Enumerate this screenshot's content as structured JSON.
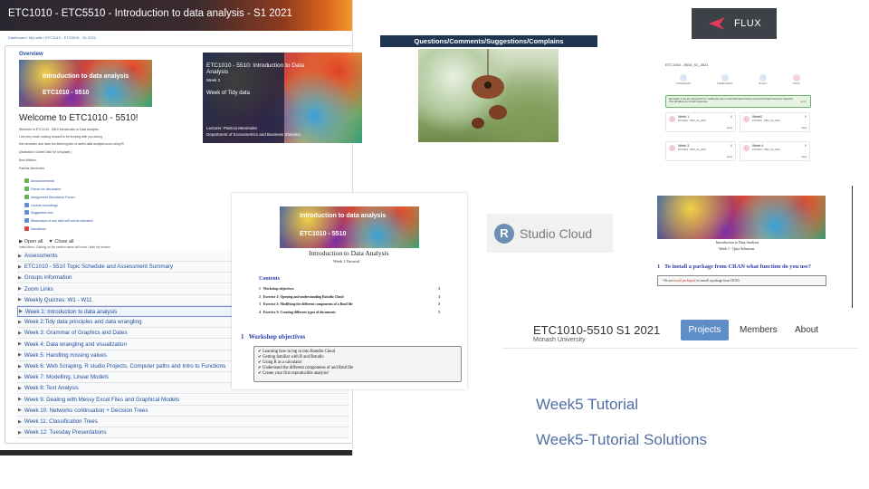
{
  "moodle": {
    "title": "ETC1010 - ETC5510 - Introduction to data analysis - S1 2021",
    "breadcrumb": "Dashboard / My units / ETC1010 - ETC5510 - S1 2021",
    "overview_label": "Overview",
    "banner_title": "Introduction to data analysis",
    "banner_code": "ETC1010 - 5510",
    "welcome": "Welcome to ETC1010 - 5510!",
    "intro_lines": [
      "Welcome to ETC1010 - 5510 Introduction to Data Analysis.",
      "I am very much looking forward to be working with you during",
      "this semester and have fun learning lots of useful data analysis tools using R!",
      "(Illustration: Daniel Olah for Unsplash )",
      "Best Wishes,",
      "Patricia Menéndez"
    ],
    "resources": [
      "Announcements",
      "Forum for discussion",
      "Assignment Discussion Forum",
      "Lecture recordings",
      "Suggestion box",
      "Misconduct of any kind will not be tolerated",
      "Disclaimer"
    ],
    "open_all": "Open all",
    "close_all": "Close all",
    "note": "Instructions: Clicking on the section name will show / hide the section.",
    "sections": [
      "Assessments",
      "ETC1010 - 5510 Topic Schedule and Assessment Summary",
      "Groups information",
      "Zoom Links",
      "Weekly Quizzes: W1 - W11",
      "Week 1: Introduction to data analysis",
      "Week 2:Tidy data principles and data wrangling",
      "Week 3: Grammar of Graphics and Dates",
      "Week 4: Data wrangling and visualization",
      "Week 5: Handling missing values",
      "Week 6: Web Scraping, R studio Projects, Computer paths and Intro to Functions",
      "Week 7: Modelling, Linear Models",
      "Week 8: Text Analysis",
      "Week 9: Dealing with Messy Excel Files and Graphical Models",
      "Week 10: Networks continuation + Decision Trees",
      "Week 11: Classification Trees",
      "Week 12: Tuesday Presentations"
    ],
    "active_section_index": 5
  },
  "slide": {
    "title": "ETC1010 - 5510: Introduction to Data Analysis",
    "week": "Week 2",
    "topic": "Week of Tidy data",
    "lecturer": "Lecturer: Patricia Menéndez",
    "dept": "Department of Econometrics and Business Statistics"
  },
  "questions_banner": "Questions/Comments/Suggestions/Complains",
  "flux": {
    "logo_text": "FLUX",
    "course": "ETC1010 - 5510_S1_2021",
    "actions": [
      "Participants",
      "Collaborators",
      "Export",
      "Trash"
    ],
    "reminder": "Reminder: If you are using FLUX for marking be sure to view Participant Access and set Participant Access to Signed in. This will allow you to track responses.",
    "reminder_btn": "got it",
    "weeks": [
      {
        "name": "Week 1",
        "sub": "ETC1010 - 5510_S1_2021",
        "count": "0",
        "action": "view"
      },
      {
        "name": "Week2",
        "sub": "ETC1010 - 5510_S1_2021",
        "count": "0",
        "action": "view"
      },
      {
        "name": "Week 3",
        "sub": "ETC1010 - 5510_S1_2021",
        "count": "0",
        "action": "view"
      },
      {
        "name": "Week 4",
        "sub": "ETC1010 - 5510_S1_2021",
        "count": "0",
        "action": "view"
      }
    ]
  },
  "rstudio": {
    "letter": "R",
    "text": "Studio Cloud"
  },
  "tutorial": {
    "banner_title": "Introduction to data analysis",
    "banner_code": "ETC1010 - 5510",
    "heading": "Introduction to Data Analysis",
    "subheading": "Week 1 Tutorial",
    "contents_title": "Contents",
    "toc": [
      {
        "num": "1",
        "label": "Workshop objectives",
        "page": "3"
      },
      {
        "num": "2",
        "label": "Exercise 1: Opening and understanding Rstudio Cloud",
        "page": "3"
      },
      {
        "num": "3",
        "label": "Exercise 2: Modifying the different components of a Rmd file",
        "page": "3"
      },
      {
        "num": "4",
        "label": "Exercise 3: Creating different types of documents",
        "page": "5"
      }
    ],
    "section_num": "1",
    "section_title": "Workshop objectives",
    "objectives": [
      "Learning how to log in into Rstudio Cloud",
      "Getting familiar with R and Rstudio",
      "Using R as a calculator",
      "Understand the different components of and Rmd file",
      "Create your first reproducible analysis!"
    ]
  },
  "quiz": {
    "title": "Introduction to Data Analysis",
    "subtitle": "Week 1 - Quiz Solutions",
    "q_num": "1",
    "q_text": "To install a package from CRAN what function do you use?",
    "answer_pre": "- We use",
    "answer_code": "install.packages()",
    "answer_post": "to install a package from CRAN."
  },
  "github": {
    "title": "ETC1010-5510 S1 2021",
    "subtitle": "Monash University",
    "tabs": [
      "Projects",
      "Members",
      "About"
    ],
    "links": [
      "Week5 Tutorial",
      "Week5-Tutorial Solutions"
    ]
  },
  "colors": {
    "link_blue": "#1f4e9a",
    "projects_blue": "#5f8ec7",
    "questions_navy": "#1f3552"
  }
}
